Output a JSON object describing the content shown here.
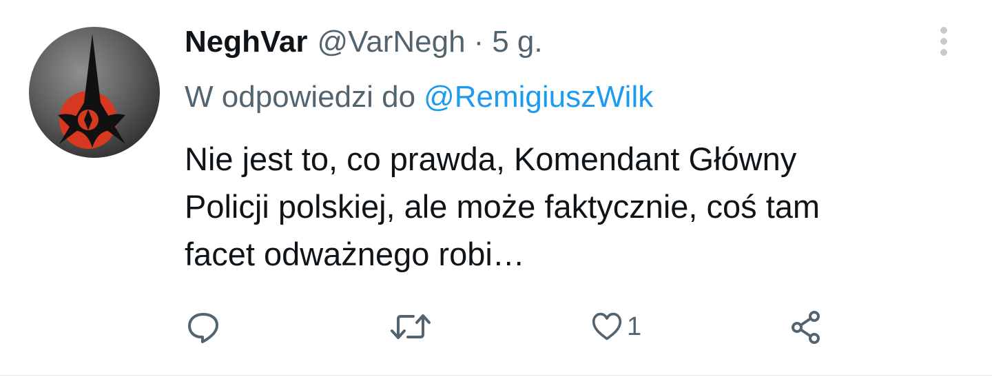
{
  "tweet": {
    "author_name": "NeghVar",
    "author_handle": "@VarNegh",
    "separator": "·",
    "time": "5 g.",
    "reply_prefix": "W odpowiedzi do",
    "reply_mention": "@RemigiuszWilk",
    "text_lines": [
      "Nie jest to, co prawda, Komendant Główny",
      "Policji polskiej, ale może faktycznie, coś tam",
      "facet odważnego robi…"
    ],
    "avatar_icon": "klingon-emblem-icon",
    "more_icon": "more-vertical-icon"
  },
  "actions": {
    "reply_icon": "reply-icon",
    "retweet_icon": "retweet-icon",
    "like_icon": "heart-icon",
    "like_count": "1",
    "share_icon": "share-icon"
  },
  "colors": {
    "text_primary": "#0f1419",
    "text_secondary": "#536471",
    "accent": "#1d9bf0",
    "icon": "#536471"
  }
}
